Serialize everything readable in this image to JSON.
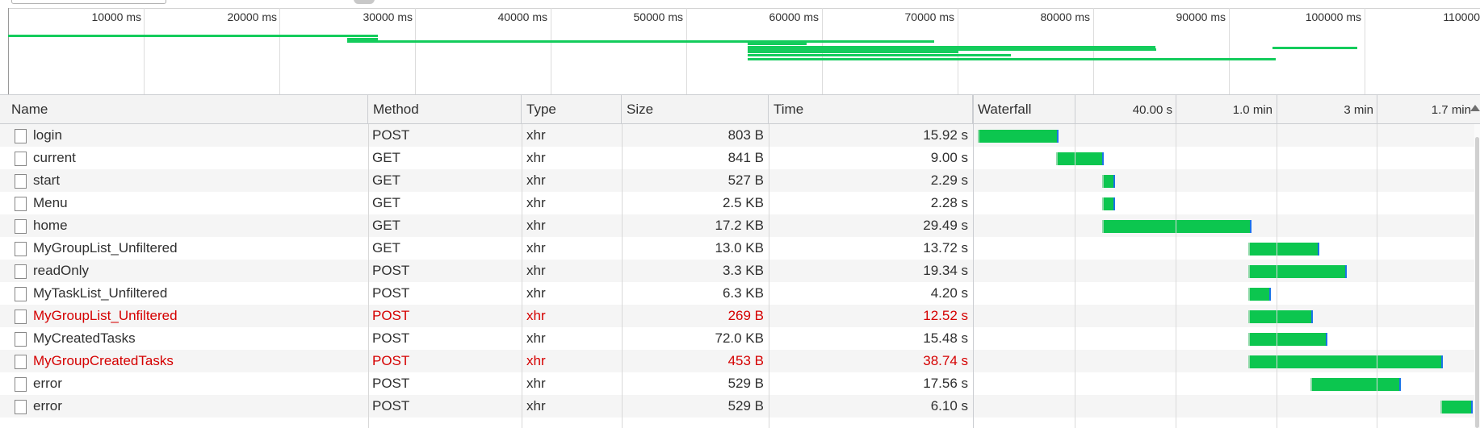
{
  "overview": {
    "tick_labels": [
      "10000 ms",
      "20000 ms",
      "30000 ms",
      "40000 ms",
      "50000 ms",
      "60000 ms",
      "70000 ms",
      "80000 ms",
      "90000 ms",
      "100000 ms",
      "110000"
    ]
  },
  "table": {
    "columns": {
      "name": "Name",
      "method": "Method",
      "type": "Type",
      "size": "Size",
      "time": "Time",
      "waterfall": "Waterfall"
    },
    "waterfall_scale": [
      "40.00 s",
      "1.0 min",
      "3 min",
      "1.7 min"
    ],
    "rows": [
      {
        "name": "login",
        "method": "POST",
        "type": "xhr",
        "size": "803 B",
        "time": "15.92 s",
        "error": false
      },
      {
        "name": "current",
        "method": "GET",
        "type": "xhr",
        "size": "841 B",
        "time": "9.00 s",
        "error": false
      },
      {
        "name": "start",
        "method": "GET",
        "type": "xhr",
        "size": "527 B",
        "time": "2.29 s",
        "error": false
      },
      {
        "name": "Menu",
        "method": "GET",
        "type": "xhr",
        "size": "2.5 KB",
        "time": "2.28 s",
        "error": false
      },
      {
        "name": "home",
        "method": "GET",
        "type": "xhr",
        "size": "17.2 KB",
        "time": "29.49 s",
        "error": false
      },
      {
        "name": "MyGroupList_Unfiltered",
        "method": "GET",
        "type": "xhr",
        "size": "13.0 KB",
        "time": "13.72 s",
        "error": false
      },
      {
        "name": "readOnly",
        "method": "POST",
        "type": "xhr",
        "size": "3.3 KB",
        "time": "19.34 s",
        "error": false
      },
      {
        "name": "MyTaskList_Unfiltered",
        "method": "POST",
        "type": "xhr",
        "size": "6.3 KB",
        "time": "4.20 s",
        "error": false
      },
      {
        "name": "MyGroupList_Unfiltered",
        "method": "POST",
        "type": "xhr",
        "size": "269 B",
        "time": "12.52 s",
        "error": true
      },
      {
        "name": "MyCreatedTasks",
        "method": "POST",
        "type": "xhr",
        "size": "72.0 KB",
        "time": "15.48 s",
        "error": false
      },
      {
        "name": "MyGroupCreatedTasks",
        "method": "POST",
        "type": "xhr",
        "size": "453 B",
        "time": "38.74 s",
        "error": true
      },
      {
        "name": "error",
        "method": "POST",
        "type": "xhr",
        "size": "529 B",
        "time": "17.56 s",
        "error": false
      },
      {
        "name": "error",
        "method": "POST",
        "type": "xhr",
        "size": "529 B",
        "time": "6.10 s",
        "error": false
      }
    ]
  },
  "colors": {
    "bar": "#0cc64f",
    "error_text": "#d50000",
    "header_bg": "#f3f3f3"
  }
}
